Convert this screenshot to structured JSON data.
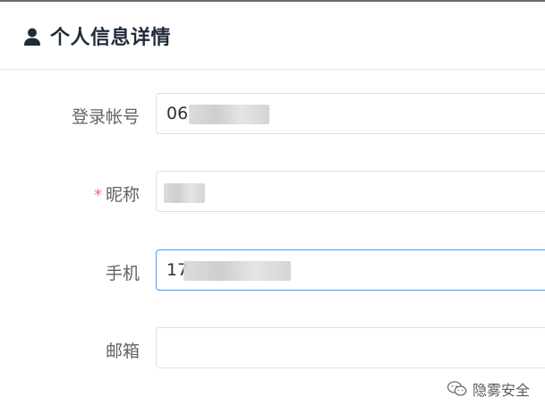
{
  "header": {
    "title": "个人信息详情",
    "icon": "user-icon"
  },
  "form": {
    "fields": [
      {
        "label": "登录帐号",
        "value": "06",
        "required": false
      },
      {
        "label": "昵称",
        "value": "",
        "required": true
      },
      {
        "label": "手机",
        "value": "17",
        "required": false
      },
      {
        "label": "邮箱",
        "value": "",
        "required": false
      }
    ],
    "required_mark": "*"
  },
  "watermark": {
    "icon": "wechat-icon",
    "text": "隐雾安全"
  },
  "colors": {
    "title": "#1f2a3b",
    "label": "#606266",
    "required": "#f56c6c",
    "input_border": "#dcdfe6",
    "focus_border": "#409eff"
  }
}
